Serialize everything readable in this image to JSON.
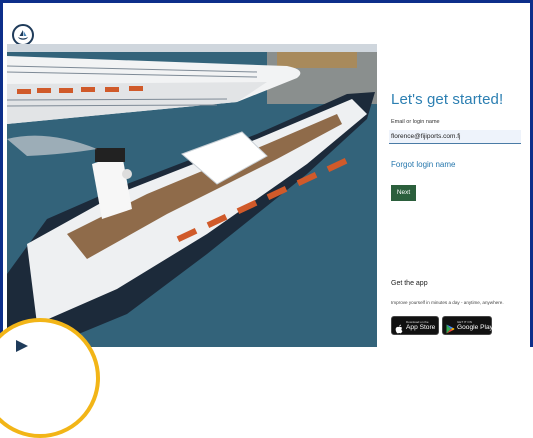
{
  "login": {
    "title": "Let's get started!",
    "email_label": "Email or login name",
    "email_value": "florence@fijiports.com.fj",
    "forgot_link": "Forgot login name",
    "next_button": "Next"
  },
  "get_app": {
    "heading": "Get the app",
    "description": "Improve yourself in minutes a day - anytime, anywhere.",
    "app_store": {
      "small": "Download on the",
      "big": "App Store"
    },
    "google_play": {
      "small": "GET IT ON",
      "big": "Google Play"
    }
  },
  "colors": {
    "frame_border": "#0d2f8a",
    "title": "#2c7fb2",
    "link": "#2677ad",
    "next_button": "#2b5f3c",
    "badge_ring": "#f2b517"
  },
  "icons": {
    "logo": "ship-logo-icon",
    "apple": "apple-icon",
    "google_play": "google-play-icon",
    "overlay_badge": "ship-logo-icon"
  },
  "hero_image": "aerial photo of cruise ships docked at a port"
}
